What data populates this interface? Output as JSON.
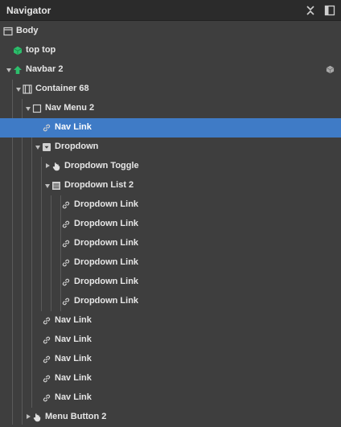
{
  "panel": {
    "title": "Navigator"
  },
  "colors": {
    "background": "#3e3e3e",
    "header": "#2b2b2b",
    "selected": "#3f7bc6",
    "symbol_green": "#2dbe6c",
    "text": "#e6e6e6"
  },
  "tree": [
    {
      "label": "Body",
      "icon": "body-icon",
      "depth": 0
    },
    {
      "label": "top top",
      "icon": "symbol-icon",
      "depth": 1
    },
    {
      "label": "Navbar 2",
      "icon": "navbar-icon",
      "depth": 1,
      "expanded": true
    },
    {
      "label": "Container 68",
      "icon": "container-icon",
      "depth": 2,
      "expanded": true
    },
    {
      "label": "Nav Menu 2",
      "icon": "box-icon",
      "depth": 3,
      "expanded": true
    },
    {
      "label": "Nav Link",
      "icon": "link-icon",
      "depth": 4,
      "selected": true
    },
    {
      "label": "Dropdown",
      "icon": "dropdown-icon",
      "depth": 4,
      "expanded": true
    },
    {
      "label": "Dropdown Toggle",
      "icon": "hand-icon",
      "depth": 5,
      "expanded": false
    },
    {
      "label": "Dropdown List 2",
      "icon": "list-icon",
      "depth": 5,
      "expanded": true
    },
    {
      "label": "Dropdown Link",
      "icon": "link-icon",
      "depth": 6
    },
    {
      "label": "Dropdown Link",
      "icon": "link-icon",
      "depth": 6
    },
    {
      "label": "Dropdown Link",
      "icon": "link-icon",
      "depth": 6
    },
    {
      "label": "Dropdown Link",
      "icon": "link-icon",
      "depth": 6
    },
    {
      "label": "Dropdown Link",
      "icon": "link-icon",
      "depth": 6
    },
    {
      "label": "Dropdown Link",
      "icon": "link-icon",
      "depth": 6
    },
    {
      "label": "Nav Link",
      "icon": "link-icon",
      "depth": 4
    },
    {
      "label": "Nav Link",
      "icon": "link-icon",
      "depth": 4
    },
    {
      "label": "Nav Link",
      "icon": "link-icon",
      "depth": 4
    },
    {
      "label": "Nav Link",
      "icon": "link-icon",
      "depth": 4
    },
    {
      "label": "Nav Link",
      "icon": "link-icon",
      "depth": 4
    },
    {
      "label": "Menu Button 2",
      "icon": "hand-icon",
      "depth": 3,
      "expanded": false
    }
  ]
}
